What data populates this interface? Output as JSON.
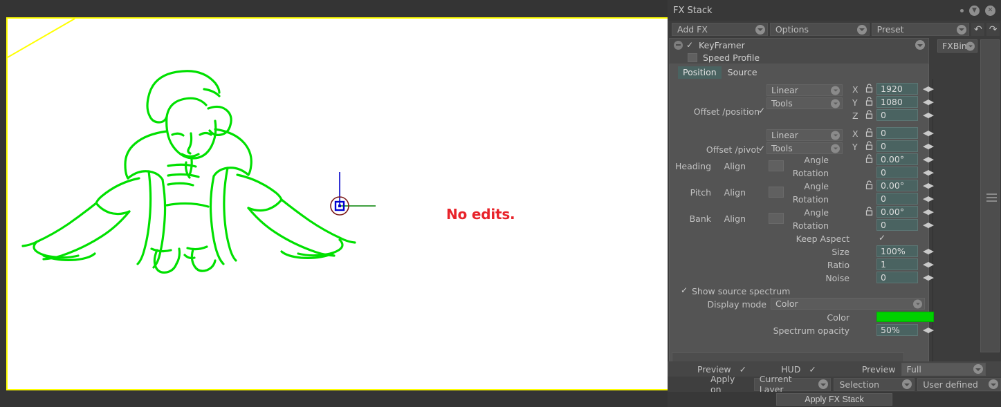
{
  "window": {
    "title": "FX Stack",
    "icons": {
      "dot": "dot-icon",
      "minimize": "minimize-icon",
      "close": "close-icon"
    }
  },
  "toolbar": {
    "add_fx": "Add FX",
    "options": "Options",
    "preset": "Preset",
    "undo": "↶",
    "redo": "↷"
  },
  "fx_list": {
    "item_name": "KeyFramer",
    "sub_item": "Speed Profile",
    "bin_label": "FXBin"
  },
  "tabs": [
    {
      "label": "Position",
      "active": true
    },
    {
      "label": "Source",
      "active": false
    }
  ],
  "params": {
    "offset_position": {
      "label": "Offset /position",
      "interp": "Linear",
      "tools": "Tools",
      "x_label": "X",
      "x_value": "1920",
      "y_label": "Y",
      "y_value": "1080",
      "z_label": "Z",
      "z_value": "0"
    },
    "offset_pivot": {
      "label": "Offset /pivot",
      "interp": "Linear",
      "tools": "Tools",
      "x_label": "X",
      "x_value": "0",
      "y_label": "Y",
      "y_value": "0"
    },
    "heading": {
      "label": "Heading",
      "align": "Align",
      "angle_label": "Angle",
      "angle_value": "0.00°",
      "rotation_label": "Rotation",
      "rotation_value": "0"
    },
    "pitch": {
      "label": "Pitch",
      "align": "Align",
      "angle_label": "Angle",
      "angle_value": "0.00°",
      "rotation_label": "Rotation",
      "rotation_value": "0"
    },
    "bank": {
      "label": "Bank",
      "align": "Align",
      "angle_label": "Angle",
      "angle_value": "0.00°",
      "rotation_label": "Rotation",
      "rotation_value": "0"
    },
    "keep_aspect": {
      "label": "Keep Aspect",
      "checked": true
    },
    "size": {
      "label": "Size",
      "value": "100%"
    },
    "ratio": {
      "label": "Ratio",
      "value": "1"
    },
    "noise": {
      "label": "Noise",
      "value": "0"
    },
    "show_source_spectrum": {
      "label": "Show source spectrum",
      "checked": true
    },
    "display_mode": {
      "label": "Display mode",
      "value": "Color"
    },
    "color": {
      "label": "Color",
      "value": "#00d100"
    },
    "spectrum_opacity": {
      "label": "Spectrum opacity",
      "value": "50%"
    }
  },
  "bottom": {
    "preview_label": "Preview",
    "hud_label": "HUD",
    "preview2_label": "Preview",
    "preview_quality": "Full",
    "apply_on_label": "Apply on",
    "apply_on_value": "Current Layer",
    "selection_value": "Selection",
    "user_defined_value": "User defined",
    "apply_button": "Apply FX Stack"
  },
  "canvas": {
    "annotation": "No edits.",
    "border_color": "#ffff00",
    "drawing_color": "#00e000",
    "annotation_color": "#e8232a",
    "gizmo": {
      "circle_color": "#7a1818",
      "vertical_axis_color": "#0000c8",
      "horizontal_axis_color": "#008000",
      "handle_color": "#0000d0"
    }
  }
}
